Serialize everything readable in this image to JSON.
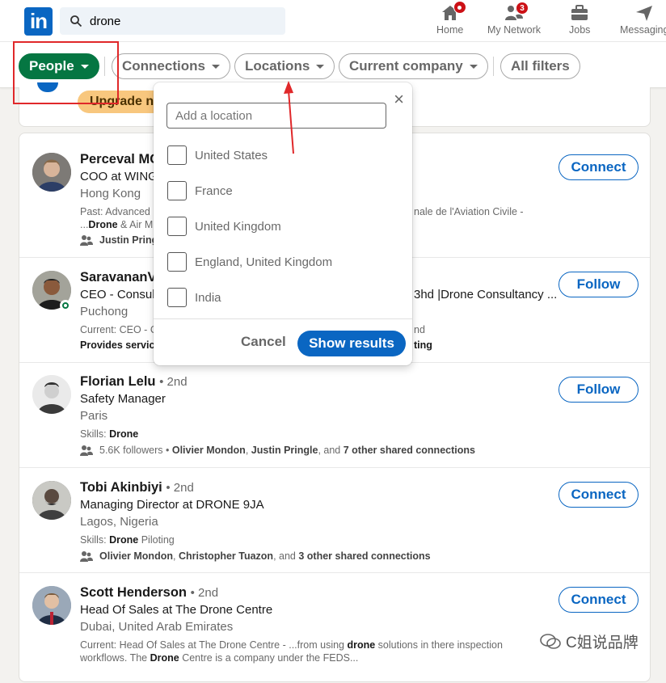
{
  "header": {
    "search_value": "drone",
    "logo_text": "in",
    "nav": [
      {
        "label": "Home",
        "badge": ""
      },
      {
        "label": "My Network",
        "badge": "3"
      },
      {
        "label": "Jobs",
        "badge": ""
      },
      {
        "label": "Messaging",
        "badge": ""
      }
    ]
  },
  "filters": {
    "people": "People",
    "connections": "Connections",
    "locations": "Locations",
    "current_company": "Current company",
    "all_filters": "All filters"
  },
  "upgrade_label": "Upgrade n",
  "location_popup": {
    "placeholder": "Add a location",
    "options": [
      "United States",
      "France",
      "United Kingdom",
      "England, United Kingdom",
      "India"
    ],
    "cancel": "Cancel",
    "show_results": "Show results",
    "close": "×"
  },
  "results": [
    {
      "name": "Perceval MC",
      "degree": "",
      "headline": "COO at WING",
      "location": "Hong Kong",
      "line1_a": "Past: Advanced",
      "line1_b": "nale de l'Aviation Civile -",
      "line2_prefix": "...",
      "line2_bold": "Drone",
      "line2_rest": " & Air M",
      "shared": "Justin Pring",
      "action": "Connect"
    },
    {
      "name": "SaravananV",
      "degree": "",
      "headline": "CEO - Consult",
      "headline_b": "3hd |Drone Consultancy ...",
      "location": "Puchong",
      "line1_a": "Current: CEO - C",
      "line1_b": "nd",
      "line2_bold": "Provides servic",
      "line2_b": "ting",
      "action": "Follow"
    },
    {
      "name": "Florian Lelu",
      "degree": "• 2nd",
      "headline": "Safety Manager",
      "location": "Paris",
      "skills_label": "Skills: ",
      "skills_bold": "Drone",
      "skills_rest": "",
      "shared_pre": "5.6K followers • ",
      "shared_b1": "Olivier Mondon",
      "shared_mid": ", ",
      "shared_b2": "Justin Pringle",
      "shared_and": ", and ",
      "shared_b3": "7 other shared connections",
      "action": "Follow"
    },
    {
      "name": "Tobi Akinbiyi",
      "degree": "• 2nd",
      "headline": "Managing Director at DRONE 9JA",
      "location": "Lagos, Nigeria",
      "skills_label": "Skills: ",
      "skills_bold": "Drone",
      "skills_rest": " Piloting",
      "shared_pre": "",
      "shared_b1": "Olivier Mondon",
      "shared_mid": ", ",
      "shared_b2": "Christopher Tuazon",
      "shared_and": ", and ",
      "shared_b3": "3 other shared connections",
      "action": "Connect"
    },
    {
      "name": "Scott Henderson",
      "degree": "• 2nd",
      "headline": "Head Of Sales at The Drone Centre",
      "location": "Dubai, United Arab Emirates",
      "line1_a": "Current: Head Of Sales at The Drone Centre - ...from using ",
      "line1_bold": "drone",
      "line1_rest": " solutions in there inspection",
      "line2_a": "workflows. The ",
      "line2_bold": "Drone",
      "line2_rest": " Centre is a company under the FEDS...",
      "action": "Connect"
    }
  ],
  "watermark": "C姐说品牌",
  "colors": {
    "brand": "#0a66c2",
    "active_filter": "#057642",
    "annotation": "#e0282a"
  }
}
